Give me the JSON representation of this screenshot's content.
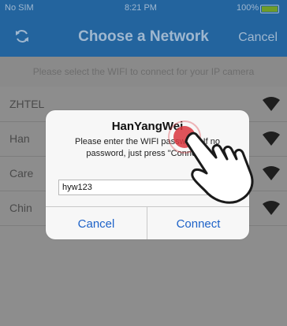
{
  "status": {
    "carrier": "No SIM",
    "time": "8:21 PM",
    "battery": "100%"
  },
  "nav": {
    "title": "Choose a Network",
    "cancel": "Cancel",
    "refresh_icon": "refresh-icon"
  },
  "subtitle": "Please select the WIFI to connect for your IP camera",
  "networks": [
    {
      "name": "ZHTEL"
    },
    {
      "name": "Han"
    },
    {
      "name": "Care"
    },
    {
      "name": "Chin"
    }
  ],
  "dialog": {
    "title": "HanYangWei",
    "message": "Please enter the WIFI password. If no password, just press \"Connect\".",
    "password_value": "hyw123",
    "cancel": "Cancel",
    "connect": "Connect"
  },
  "colors": {
    "nav": "#23649e",
    "accent": "#1d62c8",
    "tap": "#d9363e"
  }
}
